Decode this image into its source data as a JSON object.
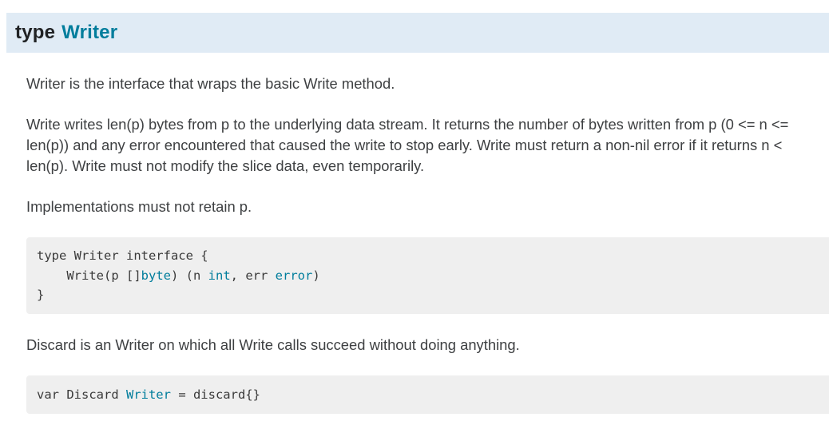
{
  "header": {
    "keyword": "type",
    "name": "Writer"
  },
  "paragraphs": {
    "intro": "Writer is the interface that wraps the basic Write method.",
    "details": "Write writes len(p) bytes from p to the underlying data stream. It returns the number of bytes written from p (0 <= n <= len(p)) and any error encountered that caused the write to stop early. Write must return a non-nil error if it returns n < len(p). Write must not modify the slice data, even temporarily.",
    "retain": "Implementations must not retain p.",
    "discard": "Discard is an Writer on which all Write calls succeed without doing anything."
  },
  "code_interface": {
    "line1": "type Writer interface {",
    "line2_a": "    Write(p []",
    "line2_byte": "byte",
    "line2_b": ") (n ",
    "line2_int": "int",
    "line2_c": ", err ",
    "line2_error": "error",
    "line2_d": ")",
    "line3": "}"
  },
  "code_discard": {
    "prefix": "var Discard ",
    "type_link": "Writer",
    "suffix": " = discard{}"
  },
  "colors": {
    "link": "#007d9c",
    "header_bg": "#e0ebf5",
    "code_bg": "#efefef"
  }
}
